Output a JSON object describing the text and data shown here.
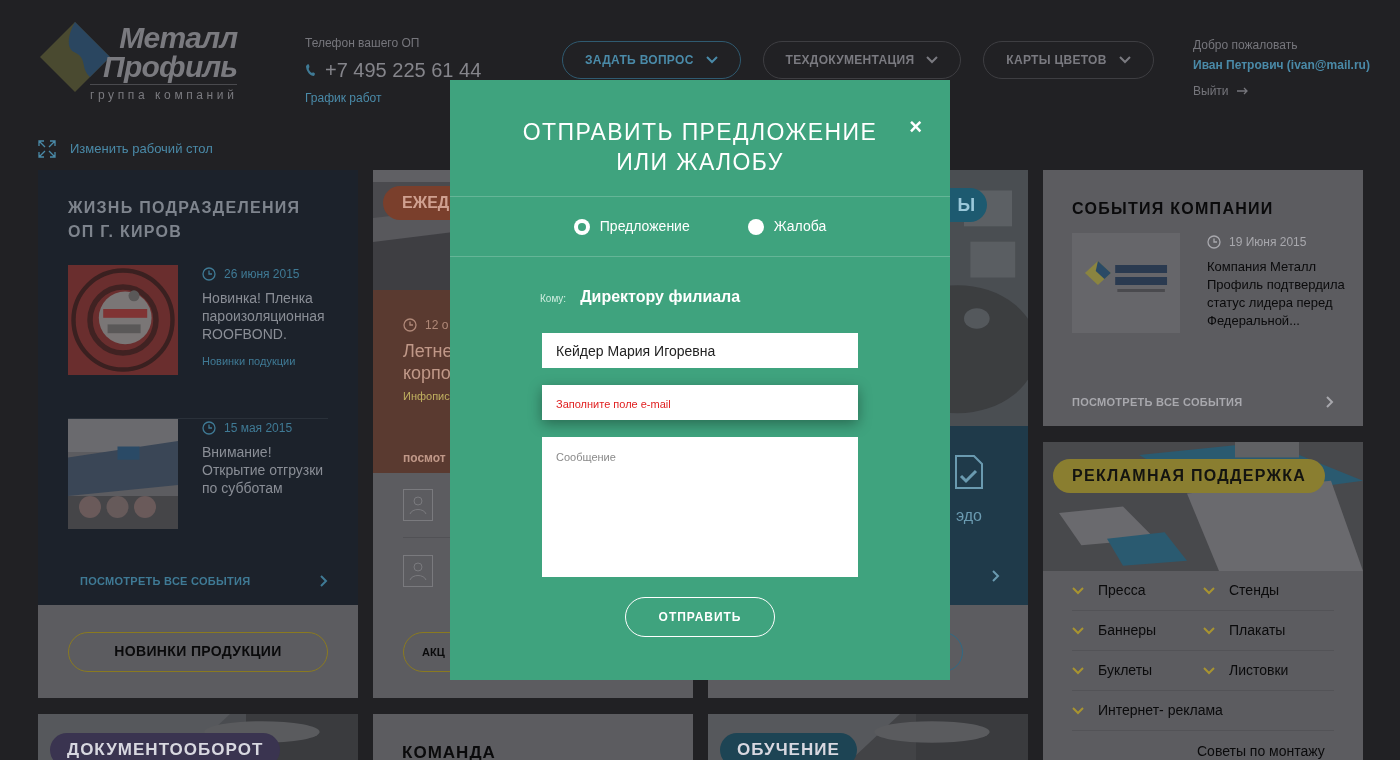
{
  "header": {
    "logo": {
      "name_line1": "Металл",
      "name_line2": "Профиль",
      "tagline": "группа компаний"
    },
    "phone": {
      "label": "Телефон вашего ОП",
      "number": "+7 495 225 61 44",
      "schedule_link": "График работ"
    },
    "nav_buttons": [
      {
        "label": "ЗАДАТЬ ВОПРОС",
        "kind": "accent"
      },
      {
        "label": "ТЕХДОКУМЕНТАЦИЯ",
        "kind": "plain"
      },
      {
        "label": "КАРТЫ ЦВЕТОВ",
        "kind": "plain"
      }
    ],
    "user": {
      "greeting": "Добро пожаловать",
      "name": "Иван Петрович (ivan@mail.ru)",
      "logout": "Выйти"
    }
  },
  "customize_link": "Изменить рабочий стол",
  "division_card": {
    "title": "ЖИЗНЬ ПОДРАЗДЕЛЕНИЯ ОП Г. КИРОВ",
    "news": [
      {
        "date": "26 июня 2015",
        "title": "Новинка! Пленка пароизоляционная ROOFBOND.",
        "tag": "Новинки подукции"
      },
      {
        "date": "15 мая 2015",
        "title": "Внимание! Открытие отгрузки по субботам"
      }
    ],
    "all_link": "ПОСМОТРЕТЬ ВСЕ СОБЫТИЯ",
    "button": "НОВИНКИ ПРОДУКЦИИ"
  },
  "weekly_card": {
    "badge": "ЕЖЕД",
    "date": "12 о",
    "title_lines": [
      "Летне",
      "корпо"
    ],
    "tag": "Инфопис",
    "link": "посмот",
    "button": "АКЦ"
  },
  "services_card": {
    "badge": "Ы",
    "item": "эдо"
  },
  "company_events_card": {
    "title": "СОБЫТИЯ КОМПАНИИ",
    "date": "19 Июня 2015",
    "text": "Компания Металл Профиль подтвердила статус лидера перед Федеральной...",
    "all_link": "ПОСМОТРЕТЬ ВСЕ СОБЫТИЯ"
  },
  "ad_card": {
    "badge": "РЕКЛАМНАЯ ПОДДЕРЖКА",
    "items": [
      "Пресса",
      "Стенды",
      "Баннеры",
      "Плакаты",
      "Буклеты",
      "Листовки",
      "Интернет- реклама"
    ],
    "extra": "Советы по монтажу"
  },
  "bottom_cards": [
    {
      "kind": "badge",
      "label": "ДОКУМЕНТООБОРОТ",
      "color": "#3a3450"
    },
    {
      "kind": "title",
      "label": "КОМАНДА"
    },
    {
      "kind": "badge",
      "label": "ОБУЧЕНИЕ",
      "color": "#1d4454"
    }
  ],
  "modal": {
    "title": "ОТПРАВИТЬ ПРЕДЛОЖЕНИЕ ИЛИ ЖАЛОБУ",
    "close": "×",
    "types": [
      {
        "label": "Предложение",
        "selected": true
      },
      {
        "label": "Жалоба",
        "selected": false
      }
    ],
    "recipient_label": "Кому:",
    "recipient": "Директору филиала",
    "fields": [
      {
        "kind": "input",
        "value": "Кейдер Мария Игоревна",
        "error": false
      },
      {
        "kind": "input",
        "placeholder": "Заполните поле e-mail",
        "error": true
      },
      {
        "kind": "textarea",
        "placeholder": "Сообщение",
        "error": false
      }
    ],
    "submit": "ОТПРАВИТЬ"
  }
}
